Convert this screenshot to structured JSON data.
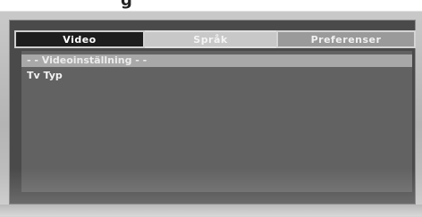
{
  "heading": {
    "partial_text": "g"
  },
  "tabs": [
    {
      "label": "Video",
      "active": true
    },
    {
      "label": "Språk",
      "active": false
    },
    {
      "label": "Preferenser",
      "active": false
    }
  ],
  "menu": {
    "section_header": "- - Videoinställning - -",
    "items": [
      {
        "label": "Tv Typ"
      }
    ]
  },
  "colors": {
    "active_tab_bg": "#1d1d1d",
    "inactive_tab_bg": "#c8c8c8",
    "panel_bg": "#626262",
    "header_bg": "#a8a8a8"
  }
}
